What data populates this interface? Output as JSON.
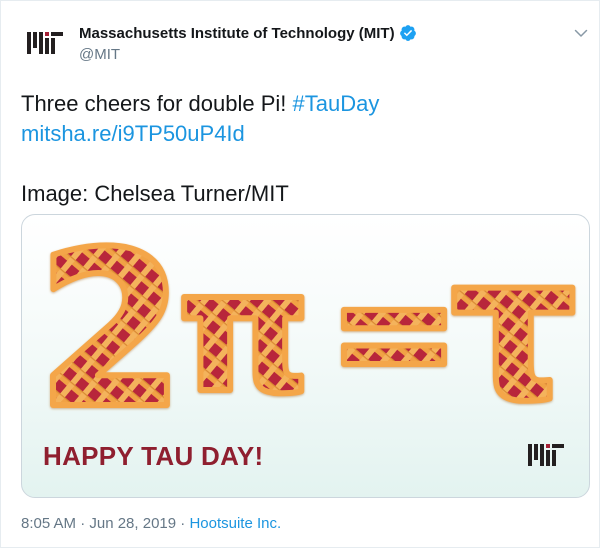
{
  "tweet": {
    "display_name": "Massachusetts Institute of Technology (MIT)",
    "handle": "@MIT",
    "text_line1": "Three cheers for double Pi! ",
    "hashtag": "#TauDay",
    "link": "mitsha.re/i9TP50uP4Id",
    "credit": "Image: Chelsea Turner/MIT",
    "timestamp": "8:05 AM · Jun 28, 2019 · ",
    "source": "Hootsuite Inc."
  },
  "media": {
    "caption": "HAPPY TAU DAY!",
    "formula": [
      "2",
      "π",
      "=",
      "τ"
    ]
  },
  "colors": {
    "link": "#1b95e0",
    "caption": "#8f1f2f",
    "crust": "#f1a245",
    "filling": "#b8283a"
  },
  "icons": [
    "mit-logo-icon",
    "verified-badge-icon",
    "chevron-down-icon"
  ]
}
